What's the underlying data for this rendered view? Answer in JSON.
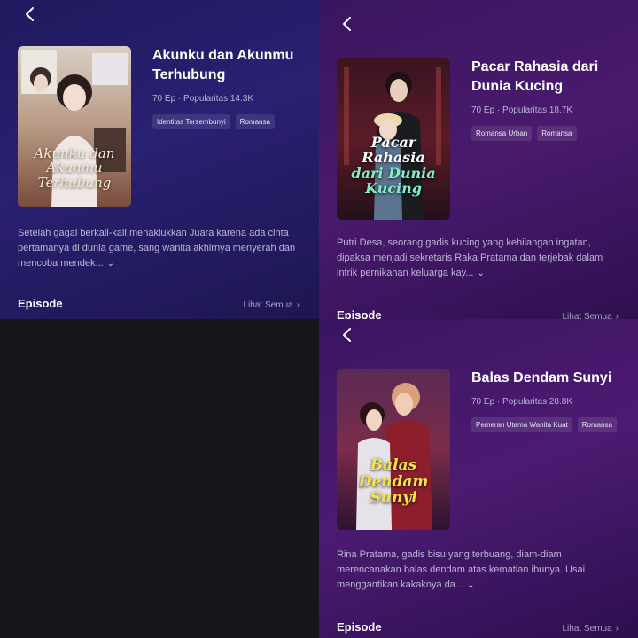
{
  "panels": [
    {
      "title": "Akunku dan Akunmu Terhubung",
      "episodes": "70 Ep",
      "separator": "·",
      "popularity": "Popularitas 14.3K",
      "tags": [
        "Identitas Tersembunyi",
        "Romansa"
      ],
      "poster_title": "Akunku dan Akunmu Terhubung",
      "description": "Setelah gagal berkali-kali menaklukkan Juara karena ada cinta pertamanya di dunia game, sang wanita akhirnya menyerah dan mencoba mendek...",
      "episode_label": "Episode",
      "see_all": "Lihat Semua"
    },
    {
      "title": "Pacar Rahasia dari Dunia Kucing",
      "episodes": "70 Ep",
      "separator": "·",
      "popularity": "Popularitas 18.7K",
      "tags": [
        "Romansa Urban",
        "Romansa"
      ],
      "poster_title_line1": "Pacar Rahasia",
      "poster_title_line2": "dari Dunia Kucing",
      "description": "Putri Desa, seorang gadis kucing yang kehilangan ingatan, dipaksa menjadi sekretaris Raka Pratama dan terjebak dalam intrik pernikahan keluarga kay...",
      "episode_label": "Episode",
      "see_all": "Lihat Semua"
    },
    {
      "title": "Balas Dendam Sunyi",
      "episodes": "70 Ep",
      "separator": "·",
      "popularity": "Popularitas 28.8K",
      "tags": [
        "Pemeran Utama Wanita Kuat",
        "Romansa"
      ],
      "poster_title": "Balas Dendam Sunyi",
      "description": "Rina Pratama, gadis bisu yang terbuang, diam-diam merencanakan balas dendam atas kematian ibunya. Usai menggantikan kakaknya da...",
      "episode_label": "Episode",
      "see_all": "Lihat Semua"
    }
  ],
  "icons": {
    "back": "chevron-left-icon",
    "expand": "chevron-down-icon",
    "see_all": "chevron-right-icon"
  },
  "colors": {
    "panel1_bg": "#2a2072",
    "panel2_bg": "#4a1a6e",
    "panel3_bg": "#4c1b72",
    "poster2_title_accent": "#7ef0c2",
    "poster3_title_accent": "#f6e34a"
  }
}
